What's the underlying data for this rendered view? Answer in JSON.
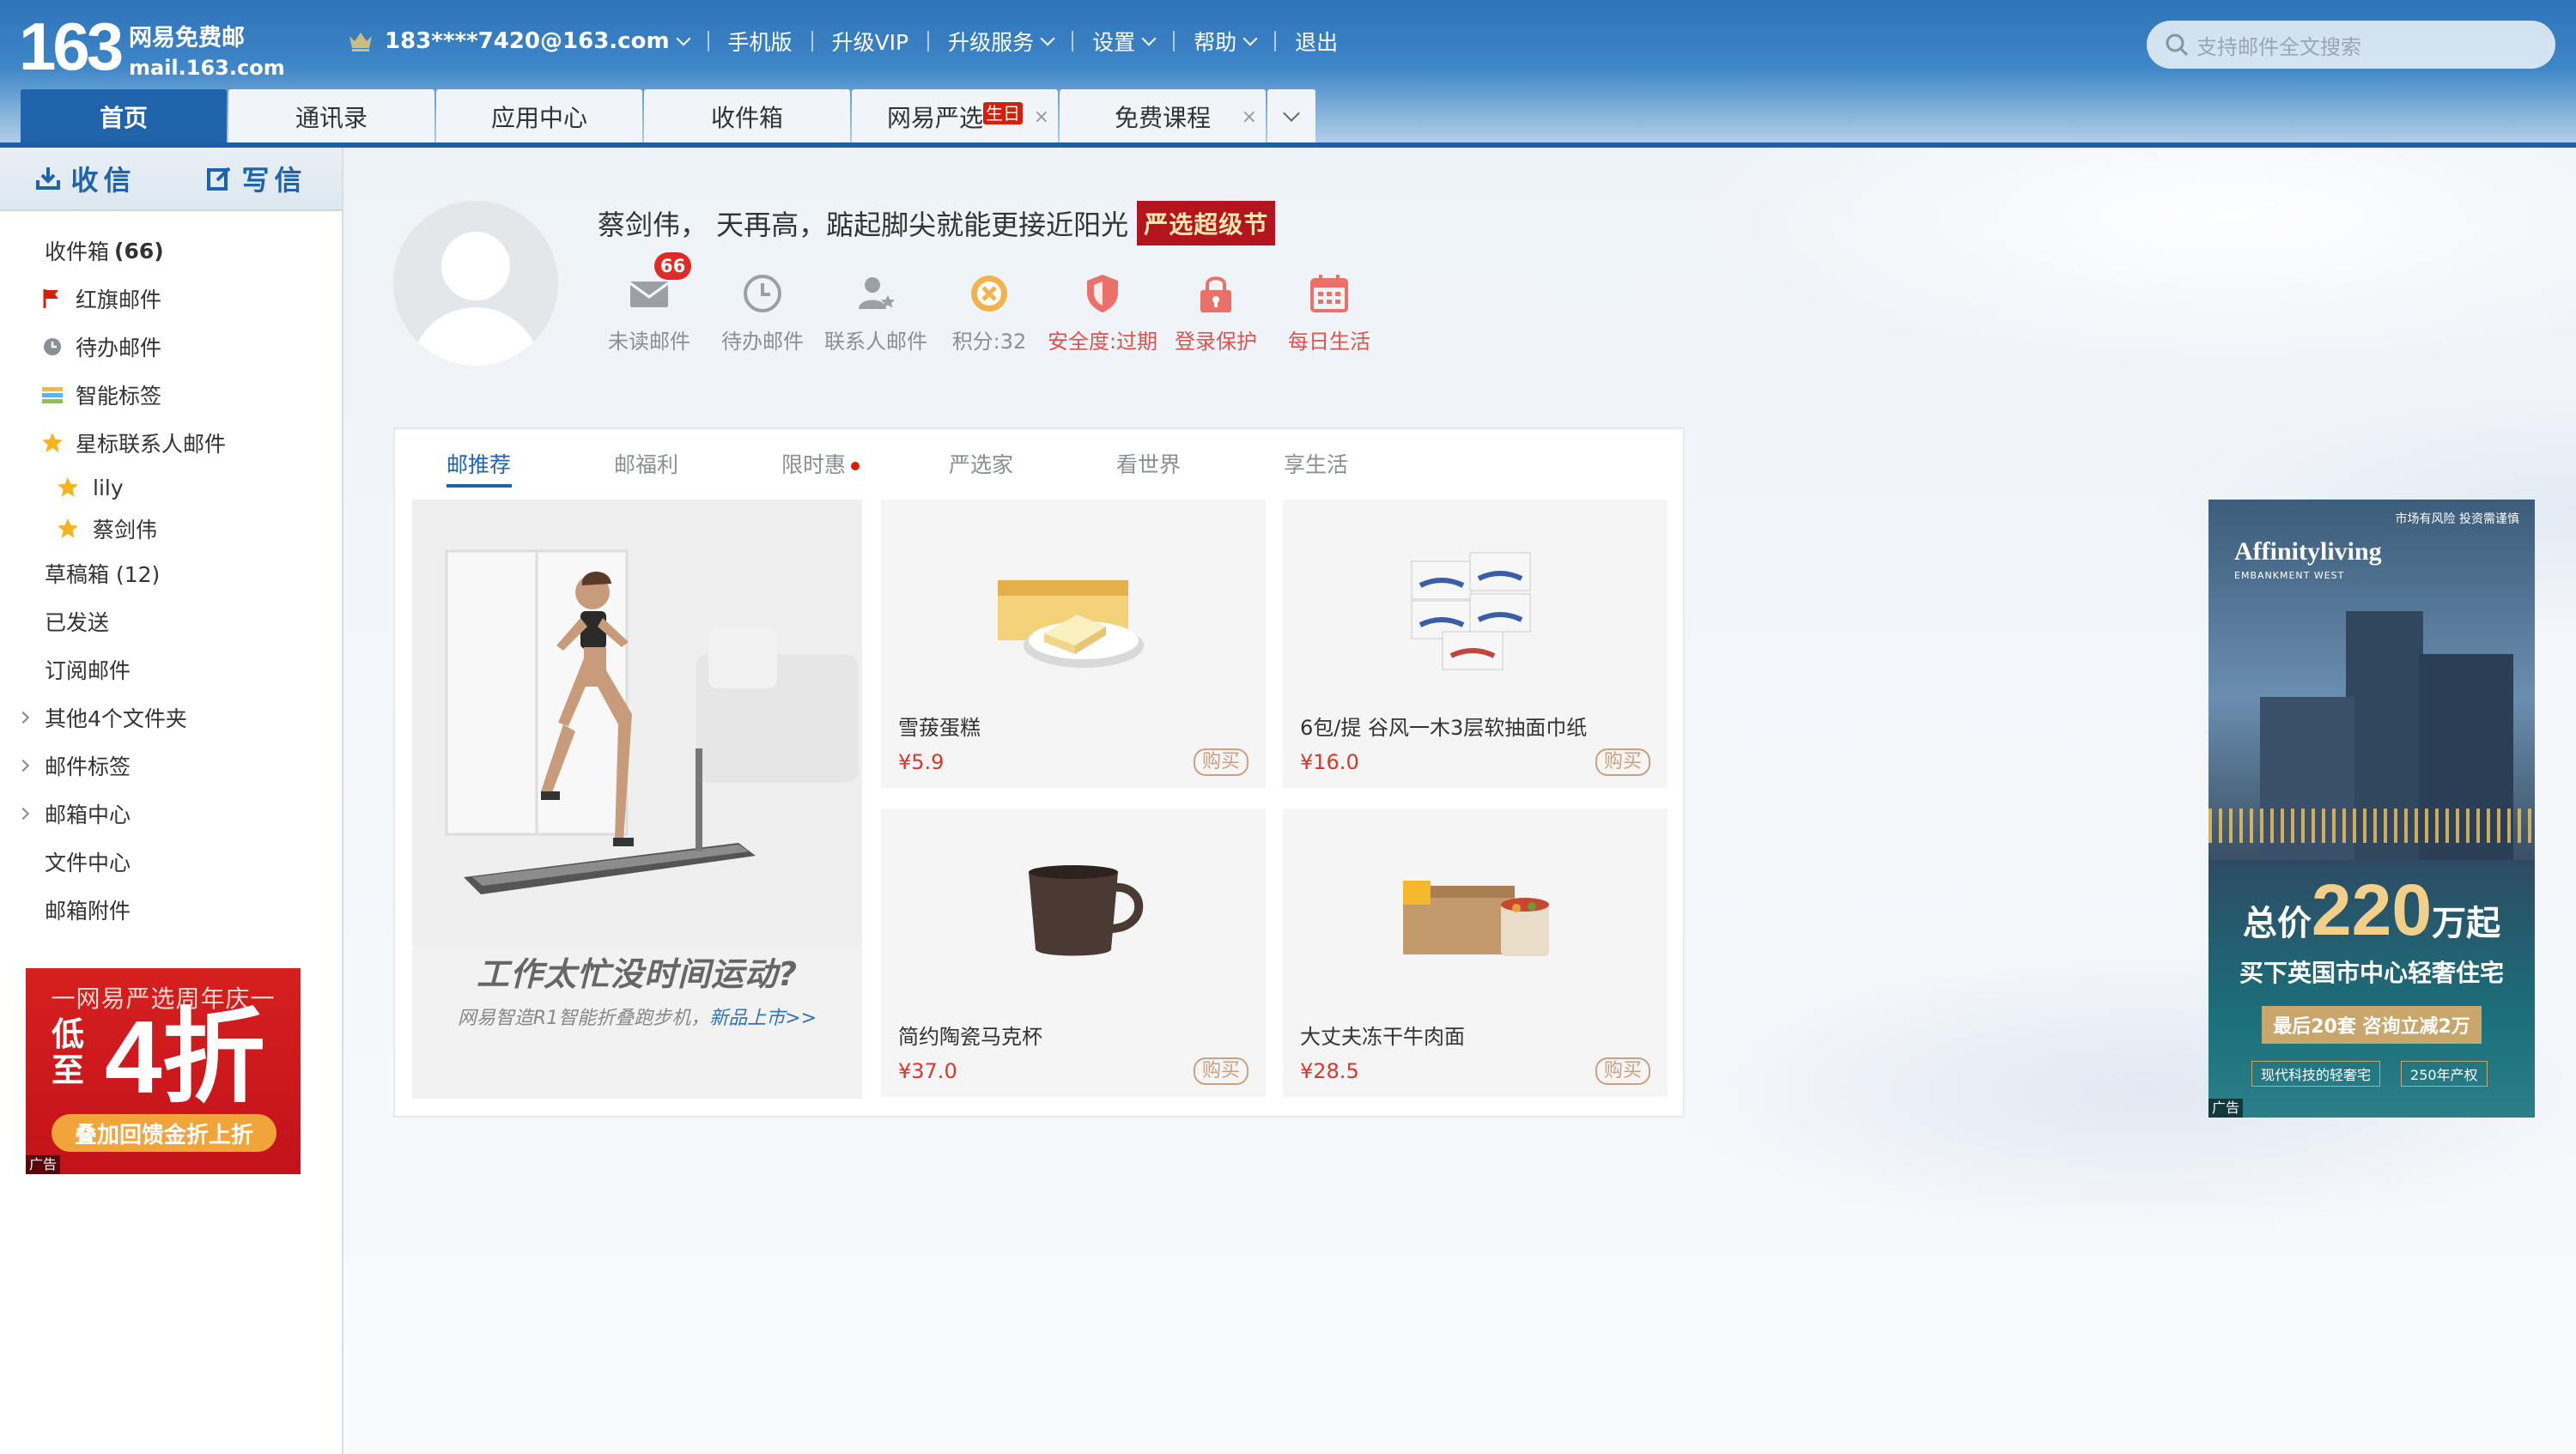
{
  "header": {
    "logo_num": "163",
    "logo_cn": "网易免费邮",
    "logo_domain": "mail.163.com",
    "account": "183****7420@163.com",
    "nav": [
      "手机版",
      "升级VIP",
      "升级服务",
      "设置",
      "帮助",
      "退出"
    ],
    "search_placeholder": "支持邮件全文搜索"
  },
  "tabs": [
    {
      "label": "首页",
      "active": true
    },
    {
      "label": "通讯录"
    },
    {
      "label": "应用中心"
    },
    {
      "label": "收件箱"
    },
    {
      "label": "网易严选",
      "badge": "生日",
      "closable": true
    },
    {
      "label": "免费课程",
      "closable": true
    }
  ],
  "sidebar": {
    "receive": "收信",
    "compose": "写信",
    "folders": [
      {
        "label": "收件箱",
        "count": "(66)"
      },
      {
        "label": "红旗邮件",
        "icon": "red-flag-icon"
      },
      {
        "label": "待办邮件",
        "icon": "clock-icon"
      },
      {
        "label": "智能标签",
        "icon": "tag-stripes-icon"
      },
      {
        "label": "星标联系人邮件",
        "icon": "star-icon"
      },
      {
        "label": "lily",
        "icon": "star-icon",
        "sub": true
      },
      {
        "label": "蔡剑伟",
        "icon": "star-icon",
        "sub": true
      },
      {
        "label": "草稿箱 (12)"
      },
      {
        "label": "已发送"
      },
      {
        "label": "订阅邮件"
      },
      {
        "label": "其他4个文件夹",
        "expandable": true
      },
      {
        "label": "邮件标签",
        "expandable": true
      },
      {
        "label": "邮箱中心",
        "expandable": true
      },
      {
        "label": "文件中心"
      },
      {
        "label": "邮箱附件"
      }
    ],
    "ad": {
      "line1": "一网易严选周年庆一",
      "line2": "低至",
      "line3": "4折",
      "line4": "叠加回馈金折上折",
      "tag": "广告"
    }
  },
  "profile": {
    "greeting": "蔡剑伟， 天再高，踮起脚尖就能更接近阳光",
    "badge": "严选超级节"
  },
  "quick_links": [
    {
      "label": "未读邮件",
      "icon": "envelope-icon",
      "badge": "66"
    },
    {
      "label": "待办邮件",
      "icon": "clock-icon"
    },
    {
      "label": "联系人邮件",
      "icon": "contact-star-icon"
    },
    {
      "label": "积分:32",
      "icon": "points-icon"
    },
    {
      "label": "安全度:过期",
      "icon": "shield-icon",
      "red": true
    },
    {
      "label": "登录保护",
      "icon": "lock-icon",
      "red": true
    },
    {
      "label": "每日生活",
      "icon": "calendar-icon",
      "red": true
    }
  ],
  "panel": {
    "tabs": [
      "邮推荐",
      "邮福利",
      "限时惠",
      "严选家",
      "看世界",
      "享生活"
    ],
    "feature": {
      "title": "工作太忙没时间运动?",
      "subtitle": "网易智造R1智能折叠跑步机，",
      "link": "新品上市>>"
    },
    "products": [
      {
        "name": "雪菝蛋糕",
        "price": "¥5.9",
        "buy": "购买"
      },
      {
        "name": "6包/提 谷风一木3层软抽面巾纸",
        "price": "¥16.0",
        "buy": "购买"
      },
      {
        "name": "简约陶瓷马克杯",
        "price": "¥37.0",
        "buy": "购买"
      },
      {
        "name": "大丈夫冻干牛肉面",
        "price": "¥28.5",
        "buy": "购买"
      }
    ]
  },
  "ad_right": {
    "top": "市场有风险 投资需谨慎",
    "brand": "Affinityliving",
    "brand_sub": "EMBANKMENT WEST",
    "line1a": "总价",
    "line1b": "220",
    "line1c": "万起",
    "line2": "买下英国市中心轻奢住宅",
    "line3": "最后20套  咨询立减2万",
    "line4a": "现代科技的轻奢宅",
    "line4b": "250年产权",
    "tag": "广告"
  }
}
